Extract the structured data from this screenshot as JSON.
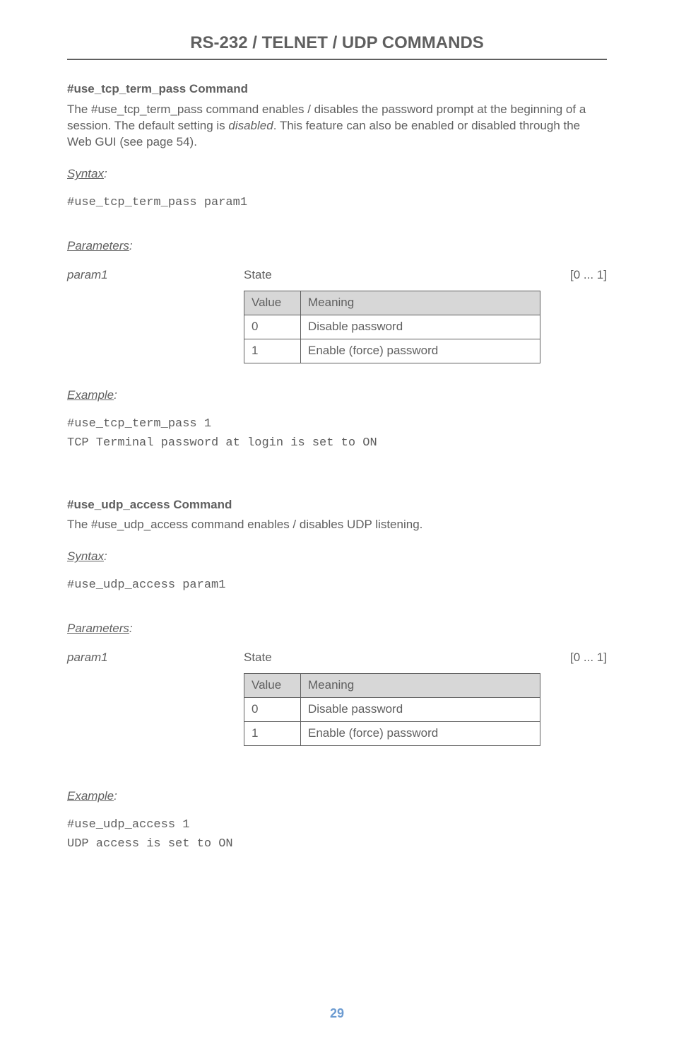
{
  "title": "RS-232 / TELNET / UDP COMMANDS",
  "cmd1": {
    "heading": "#use_tcp_term_pass Command",
    "desc_pre": "The #use_tcp_term_pass command enables / disables the password prompt at the beginning of a session.  The default setting is ",
    "desc_em": "disabled",
    "desc_post": ".  This feature can also be enabled or disabled through the Web GUI (see page 54).",
    "syntax_label": "Syntax",
    "syntax_colon": ":",
    "syntax_code": "#use_tcp_term_pass param1",
    "params_label": "Parameters",
    "params_colon": ":",
    "param_name": "param1",
    "param_state": "State",
    "param_range": "[0 ... 1]",
    "table": {
      "h1": "Value",
      "h2": "Meaning",
      "rows": [
        {
          "v": "0",
          "m": "Disable password"
        },
        {
          "v": "1",
          "m": "Enable (force) password"
        }
      ]
    },
    "example_label": "Example",
    "example_colon": ":",
    "example_lines": [
      "#use_tcp_term_pass 1",
      "TCP Terminal password at login is set to ON"
    ]
  },
  "cmd2": {
    "heading": "#use_udp_access Command",
    "desc": "The #use_udp_access command enables / disables UDP listening.",
    "syntax_label": "Syntax",
    "syntax_colon": ":",
    "syntax_code": "#use_udp_access param1",
    "params_label": "Parameters",
    "params_colon": ":",
    "param_name": "param1",
    "param_state": "State",
    "param_range": "[0 ... 1]",
    "table": {
      "h1": "Value",
      "h2": "Meaning",
      "rows": [
        {
          "v": "0",
          "m": "Disable password"
        },
        {
          "v": "1",
          "m": "Enable (force) password"
        }
      ]
    },
    "example_label": "Example",
    "example_colon": ":",
    "example_lines": [
      "#use_udp_access 1",
      "UDP access is set to ON"
    ]
  },
  "page_number": "29"
}
